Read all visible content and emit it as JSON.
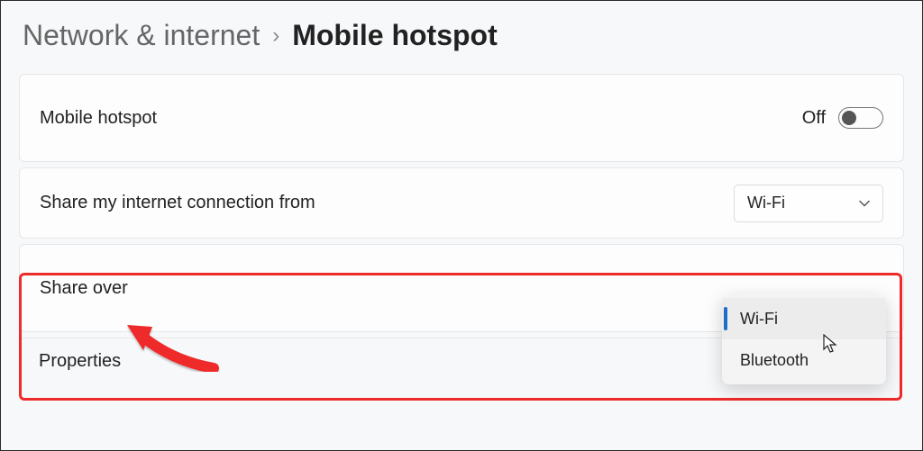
{
  "breadcrumb": {
    "parent": "Network & internet",
    "current": "Mobile hotspot"
  },
  "rows": {
    "hotspot": {
      "label": "Mobile hotspot",
      "state_label": "Off"
    },
    "share_from": {
      "label": "Share my internet connection from",
      "value": "Wi-Fi"
    },
    "share_over": {
      "label": "Share over",
      "options": [
        "Wi-Fi",
        "Bluetooth"
      ]
    },
    "properties": {
      "label": "Properties"
    }
  },
  "annotation": {
    "highlight_color": "#ee2b2b"
  }
}
